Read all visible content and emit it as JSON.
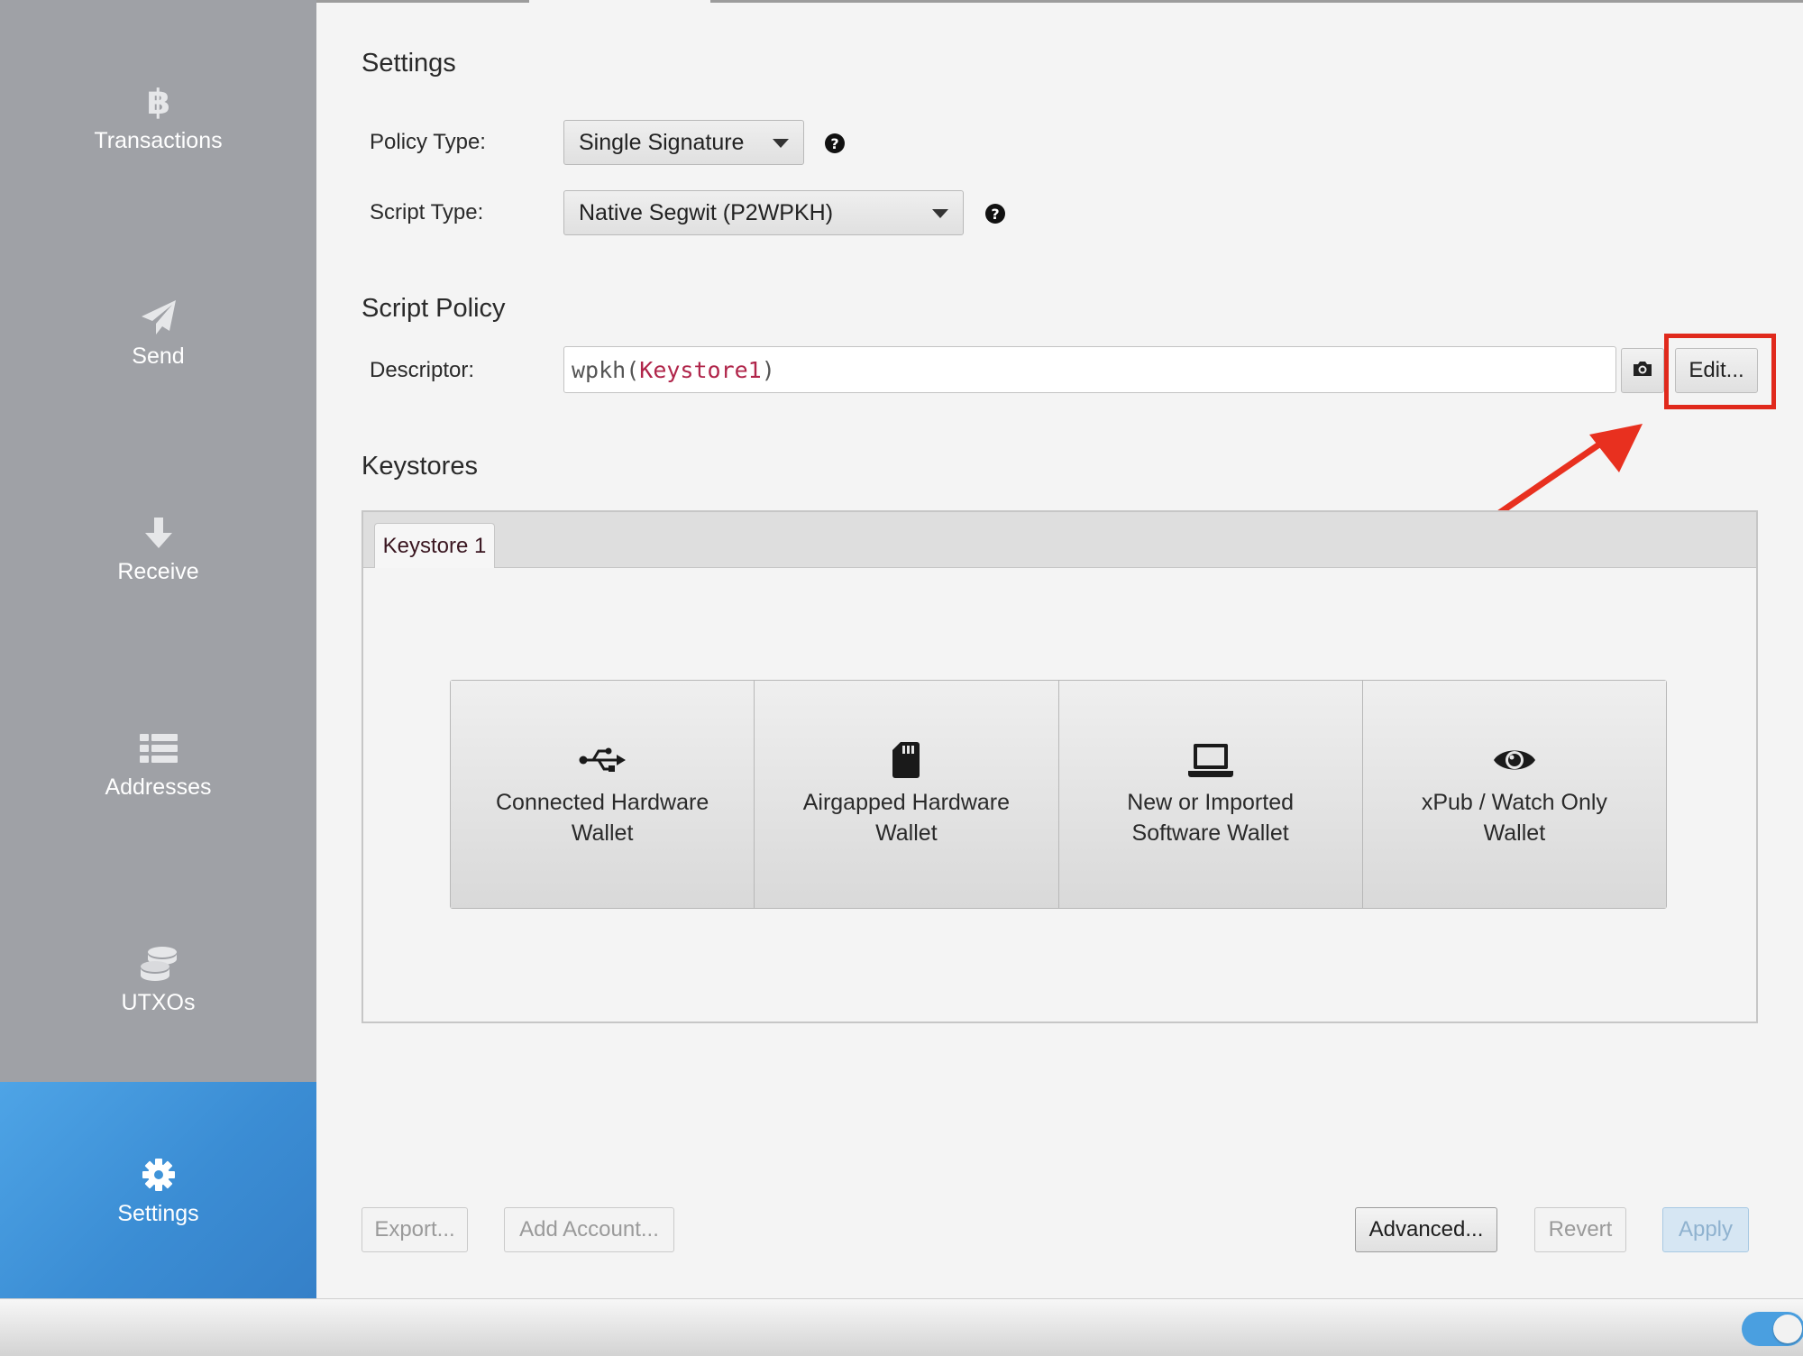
{
  "sidebar": {
    "items": [
      {
        "label": "Transactions",
        "icon": "bitcoin-icon"
      },
      {
        "label": "Send",
        "icon": "send-icon"
      },
      {
        "label": "Receive",
        "icon": "arrow-down-icon"
      },
      {
        "label": "Addresses",
        "icon": "list-icon"
      },
      {
        "label": "UTXOs",
        "icon": "coins-icon"
      },
      {
        "label": "Settings",
        "icon": "gear-icon",
        "active": true
      }
    ]
  },
  "settings": {
    "title": "Settings",
    "policy_type_label": "Policy Type:",
    "policy_type_value": "Single Signature",
    "script_type_label": "Script Type:",
    "script_type_value": "Native Segwit (P2WPKH)"
  },
  "script_policy": {
    "title": "Script Policy",
    "descriptor_label": "Descriptor:",
    "descriptor_prefix": "wpkh(",
    "descriptor_keystore": "Keystore1",
    "descriptor_suffix": ")",
    "edit_label": "Edit..."
  },
  "keystores": {
    "title": "Keystores",
    "tab_label": "Keystore 1",
    "wallet_options": [
      {
        "line1": "Connected Hardware",
        "line2": "Wallet",
        "icon": "usb-icon"
      },
      {
        "line1": "Airgapped Hardware",
        "line2": "Wallet",
        "icon": "sd-card-icon"
      },
      {
        "line1": "New or Imported",
        "line2": "Software Wallet",
        "icon": "laptop-icon"
      },
      {
        "line1": "xPub / Watch Only",
        "line2": "Wallet",
        "icon": "eye-icon"
      }
    ]
  },
  "footer": {
    "export_label": "Export...",
    "add_account_label": "Add Account...",
    "advanced_label": "Advanced...",
    "revert_label": "Revert",
    "apply_label": "Apply"
  },
  "annotation": {
    "highlight_color": "#e0291c"
  },
  "colors": {
    "sidebar": "#9fa1a6",
    "active": "#3b8dd4",
    "keyword": "#b0254a"
  }
}
